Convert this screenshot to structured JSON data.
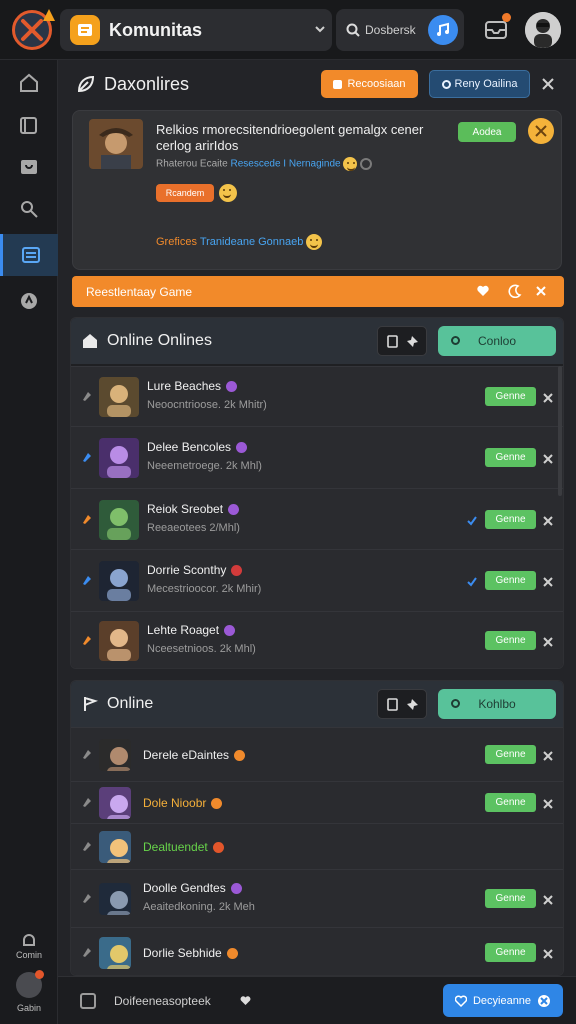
{
  "header": {
    "app_title": "Komunitas",
    "search_label": "Dosbersk",
    "colors": {
      "accent": "#f5a11c",
      "blue": "#3b8cf0",
      "logo_ring": "#e25a2c"
    }
  },
  "sidebar": {
    "items": [
      {
        "icon": "home-icon"
      },
      {
        "icon": "pages-icon"
      },
      {
        "icon": "chat-icon"
      },
      {
        "icon": "people-icon"
      },
      {
        "icon": "list-icon",
        "active": true
      },
      {
        "icon": "discover-icon"
      }
    ],
    "footer_label": "Comin",
    "footer_avatar_label": "Gabin"
  },
  "featured": {
    "title": "Daxonlires",
    "orange_button": "Recoosiaan",
    "blue_button": "Reny Oailina",
    "card": {
      "title": "Relkios rmorecsitendrioegolent gemalgx cener cerlog arirIdos",
      "meta_prefix": "Rhaterou Ecaite",
      "meta_link": "Resescede I Nernaginde",
      "pill": "Rcandem",
      "footer_orange": "Grefices",
      "footer_blue": "Tranideane Gonnaeb",
      "status": "Aodea"
    },
    "banner": "Reestlentaay Game"
  },
  "groups": [
    {
      "title": "Online  Onlines",
      "button": "Conloo",
      "rows": [
        {
          "name": "Lure Beaches",
          "sub": "Neoocntrioose. 2k Mhitr)",
          "action": "Genne",
          "lead_color": "#8a8a8a",
          "tag_color": "#9b59d6",
          "tick": false
        },
        {
          "name": "Delee Bencoles",
          "sub": "Neeemetroege. 2k Mhl)",
          "action": "Genne",
          "lead_color": "#3b8cf0",
          "tag_color": "#9b59d6",
          "tick": false
        },
        {
          "name": "Reiok Sreobet",
          "sub": "Reeaeotees 2/Mhl)",
          "action": "Genne",
          "lead_color": "#f08a2c",
          "tag_color": "#9b59d6",
          "tick": true
        },
        {
          "name": "Dorrie Sconthy",
          "sub": "Mecestrioocor. 2k Mhir)",
          "action": "Genne",
          "lead_color": "#3b8cf0",
          "tag_color": "#d23b3b",
          "tick": true
        },
        {
          "name": "Lehte Roaget",
          "sub": "Nceesetnioos. 2k Mhl)",
          "action": "Genne",
          "lead_color": "#f08a2c",
          "tag_color": "#9b59d6",
          "tick": false
        }
      ]
    },
    {
      "title": "Online",
      "button": "Kohlbo",
      "rows": [
        {
          "name": "Derele eDaintes",
          "sub": "",
          "action": "Genne",
          "name_color": "#f0f0f0",
          "tag_color": "#f08a2c"
        },
        {
          "name": "Dole Nioobr",
          "sub": "",
          "action": "Genne",
          "name_color": "#f5b03a",
          "tag_color": "#f08a2c"
        },
        {
          "name": "Dealtuendet",
          "sub": "",
          "action": "",
          "name_color": "#67d34a",
          "tag_color": "#e2562b"
        },
        {
          "name": "Doolle Gendtes",
          "sub": "Aeaitedkoning. 2k Meh",
          "action": "Genne",
          "name_color": "#f0f0f0",
          "tag_color": "#9b59d6"
        },
        {
          "name": "Dorlie Sebhide",
          "sub": "",
          "action": "Genne",
          "name_color": "#f0f0f0",
          "tag_color": "#f08a2c"
        }
      ]
    }
  ],
  "bottom": {
    "input_text": "Doifeeneasopteek",
    "button": "Decyieanne"
  }
}
